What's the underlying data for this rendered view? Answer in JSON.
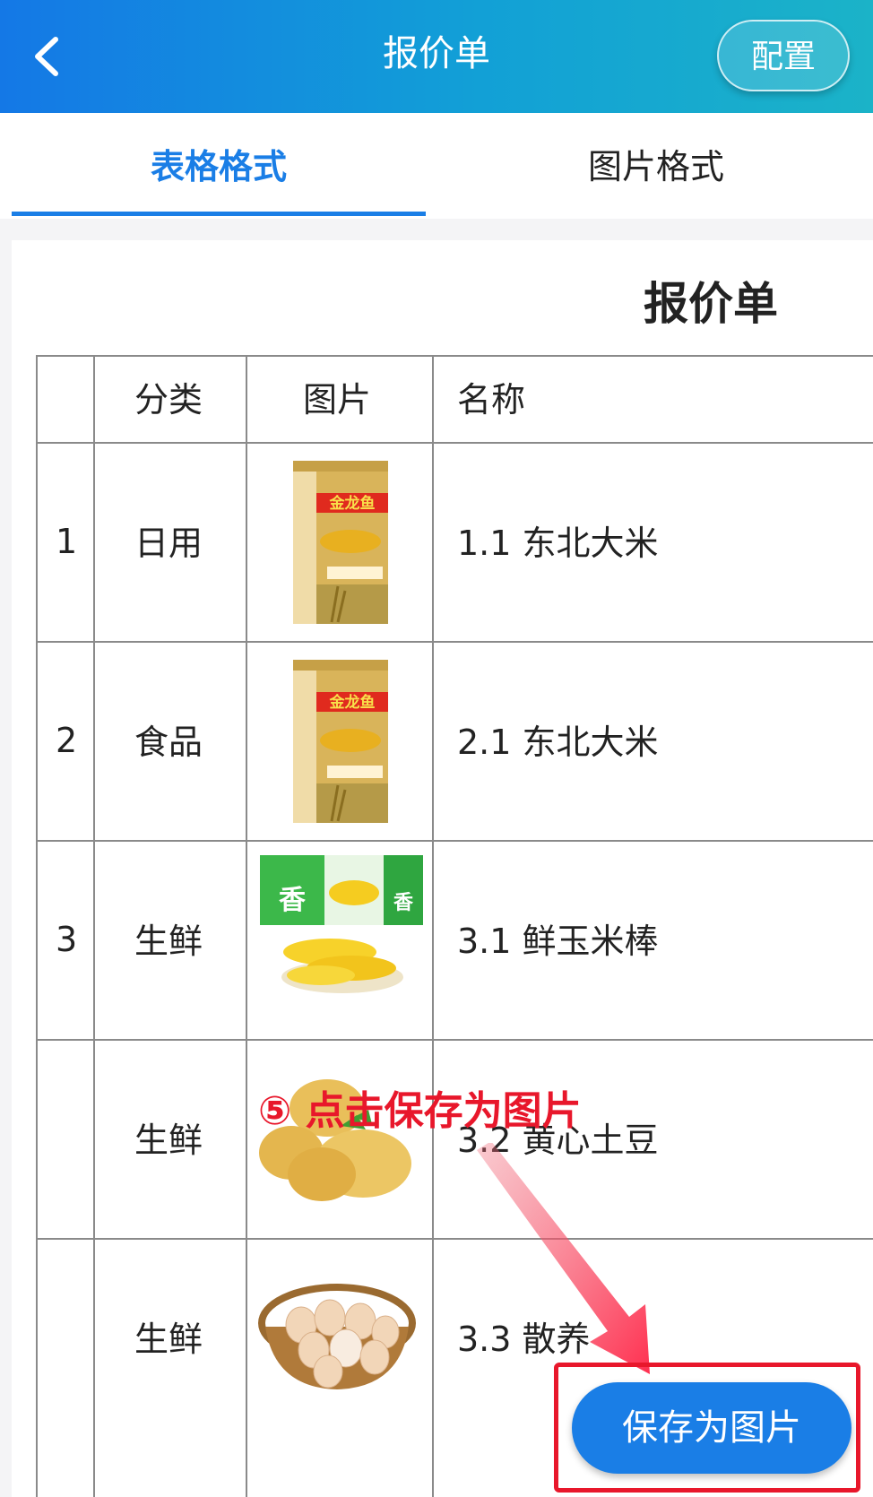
{
  "header": {
    "title": "报价单",
    "config_label": "配置"
  },
  "tabs": [
    {
      "label": "表格格式",
      "active": true
    },
    {
      "label": "图片格式",
      "active": false
    }
  ],
  "sheet": {
    "title": "报价单",
    "columns": [
      "",
      "分类",
      "图片",
      "名称"
    ],
    "rows": [
      {
        "index": "1",
        "category": "日用",
        "image": "rice-bag-image",
        "name": "1.1 东北大米"
      },
      {
        "index": "2",
        "category": "食品",
        "image": "rice-bag-image",
        "name": "2.1 东北大米"
      },
      {
        "index": "3",
        "category": "生鲜",
        "image": "corn-image",
        "name": "3.1 鲜玉米棒"
      },
      {
        "index": "",
        "category": "生鲜",
        "image": "potato-image",
        "name": "3.2 黄心土豆"
      },
      {
        "index": "",
        "category": "生鲜",
        "image": "egg-basket-image",
        "name": "3.3 散养"
      }
    ]
  },
  "annotation": {
    "text": "⑤ 点击保存为图片"
  },
  "actions": {
    "save_image_label": "保存为图片"
  },
  "colors": {
    "accent": "#1a7ee6",
    "annotation_red": "#e8172b"
  }
}
